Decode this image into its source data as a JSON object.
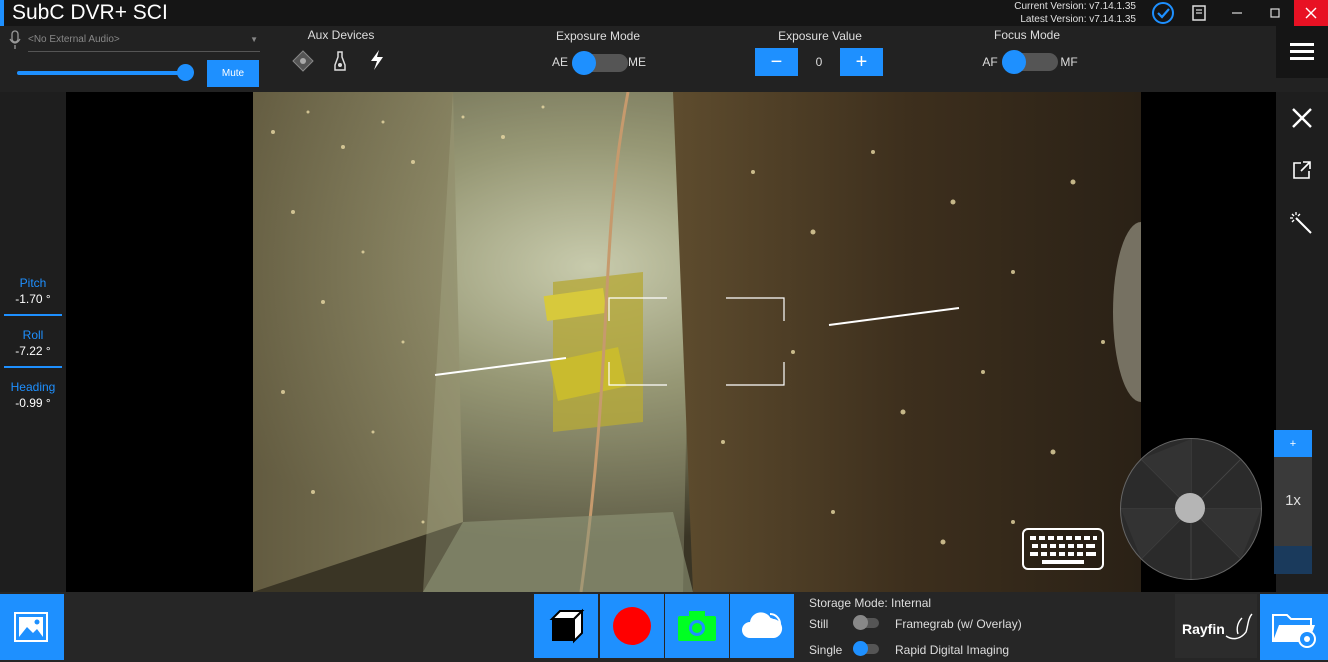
{
  "titlebar": {
    "title": "SubC DVR+ SCI",
    "current_version": "Current Version: v7.14.1.35",
    "latest_version": "Latest Version: v7.14.1.35",
    "icons": [
      "check-circle-icon",
      "book-icon",
      "minimize-icon",
      "maximize-icon",
      "close-icon"
    ]
  },
  "audio": {
    "placeholder": "<No External Audio>",
    "volume_percent": 100,
    "mute_label": "Mute"
  },
  "aux_devices": {
    "label": "Aux Devices",
    "icons": [
      "laser-icon",
      "light-icon",
      "strobe-icon"
    ]
  },
  "exposure_mode": {
    "label": "Exposure Mode",
    "left": "AE",
    "right": "ME",
    "selected": "AE"
  },
  "exposure_value": {
    "label": "Exposure Value",
    "minus": "−",
    "value": "0",
    "plus": "+"
  },
  "focus_mode": {
    "label": "Focus Mode",
    "left": "AF",
    "right": "MF",
    "selected": "AF"
  },
  "telemetry": [
    {
      "label": "Pitch",
      "value": "-1.70 °"
    },
    {
      "label": "Roll",
      "value": "-7.22 °"
    },
    {
      "label": "Heading",
      "value": "-0.99 °"
    }
  ],
  "right_tools": [
    "close-overlay-icon",
    "pop-out-icon",
    "magic-wand-icon"
  ],
  "zoom": {
    "plus": "+",
    "level": "1x"
  },
  "storage": {
    "mode": "Storage Mode: Internal",
    "row1_left": "Still",
    "row1_right": "Framegrab (w/ Overlay)",
    "row2_left": "Single",
    "row2_right": "Rapid Digital Imaging",
    "row1_on": false,
    "row2_on": true
  },
  "actions": [
    "3d-model-icon",
    "record-icon",
    "camera-icon",
    "cloud-upload-icon"
  ],
  "brand": {
    "logo_text": "Rayfin"
  },
  "colors": {
    "accent": "#1e90ff",
    "record": "#ff0000",
    "camera": "#00ff22",
    "close": "#e81123"
  }
}
